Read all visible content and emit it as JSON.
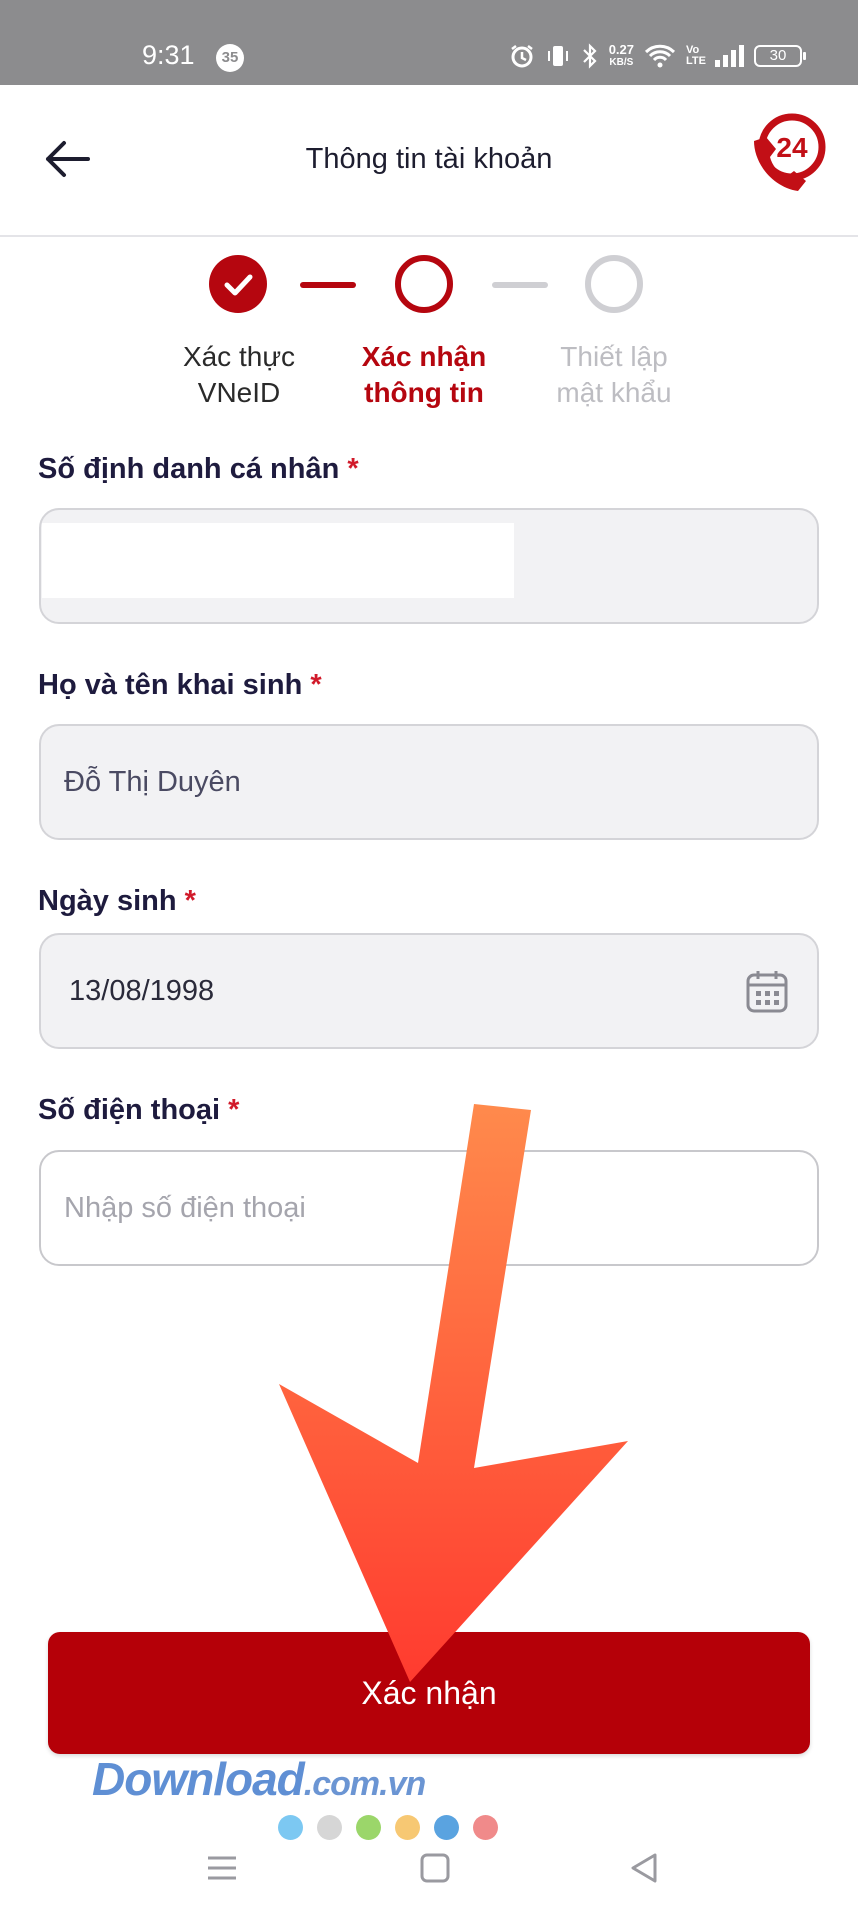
{
  "status_bar": {
    "time": "9:31",
    "notification_count": "35",
    "net_speed_value": "0.27",
    "net_speed_unit": "KB/S",
    "volte": "Vo LTE",
    "battery": "30"
  },
  "header": {
    "title": "Thông tin tài khoản",
    "hotline_badge": "24"
  },
  "stepper": {
    "steps": [
      {
        "line1": "Xác thực",
        "line2": "VNeID",
        "state": "done"
      },
      {
        "line1": "Xác nhận",
        "line2": "thông tin",
        "state": "active"
      },
      {
        "line1": "Thiết lập",
        "line2": "mật khẩu",
        "state": "pending"
      }
    ]
  },
  "form": {
    "required_mark": "*",
    "id_number": {
      "label": "Số định danh cá nhân",
      "value": ""
    },
    "full_name": {
      "label": "Họ và tên khai sinh",
      "value": "Đỗ Thị Duyên"
    },
    "birth_date": {
      "label": "Ngày sinh",
      "value": "13/08/1998"
    },
    "phone": {
      "label": "Số điện thoại",
      "value": "",
      "placeholder": "Nhập số điện thoại"
    }
  },
  "submit_label": "Xác nhận",
  "watermark": {
    "brand": "Download",
    "tld": ".com.vn"
  },
  "colors": {
    "accent": "#b5060f",
    "button": "#b50008",
    "arrow_top": "#ff8a4c",
    "arrow_bottom": "#ff3b2f",
    "dots": [
      "#7cc8f2",
      "#d6d6d6",
      "#9bd66a",
      "#f7c873",
      "#5aa3e0",
      "#f08a8a"
    ]
  },
  "icons": {
    "back": "arrow-left-icon",
    "hotline": "phone-24-icon",
    "calendar": "calendar-icon",
    "step_done": "check-icon"
  }
}
